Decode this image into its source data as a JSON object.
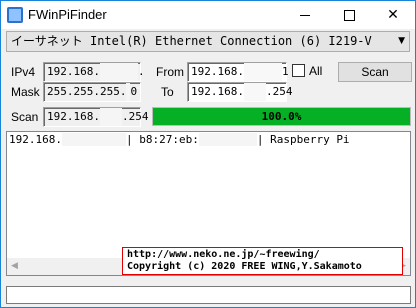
{
  "window": {
    "title": "FWinPiFinder",
    "minimize": "—",
    "maximize": "☐",
    "close": "✕"
  },
  "adapter": {
    "selected": "イーサネット Intel(R) Ethernet Connection (6) I219-V",
    "arrow": "▼"
  },
  "labels": {
    "ipv4": "IPv4",
    "mask": "Mask",
    "from": "From",
    "to": "To",
    "all": "All",
    "scan": "Scan"
  },
  "ipv4": {
    "prefix": "192.168.",
    "suffix": "."
  },
  "mask": {
    "prefix": "255.255.255.",
    "suffix": "0"
  },
  "from": {
    "prefix": "192.168.",
    "suffix": "1"
  },
  "to": {
    "prefix": "192.168.",
    "suffix": ".254"
  },
  "scan_field": {
    "prefix": "192.168.",
    "suffix": ".254"
  },
  "all_checked": false,
  "scan_button": "Scan",
  "progress": {
    "value": 1.0,
    "text": "100.0%"
  },
  "results": [
    {
      "ip": "192.168.",
      "sep1": "| b8:27:eb:",
      "sep2": "| Raspberry Pi"
    }
  ],
  "credits": {
    "line1": "http://www.neko.ne.jp/~freewing/",
    "line2": "Copyright (c) 2020 FREE WING,Y.Sakamoto"
  },
  "scrollbar": {
    "left": "◀",
    "right": "▶"
  },
  "status": ""
}
